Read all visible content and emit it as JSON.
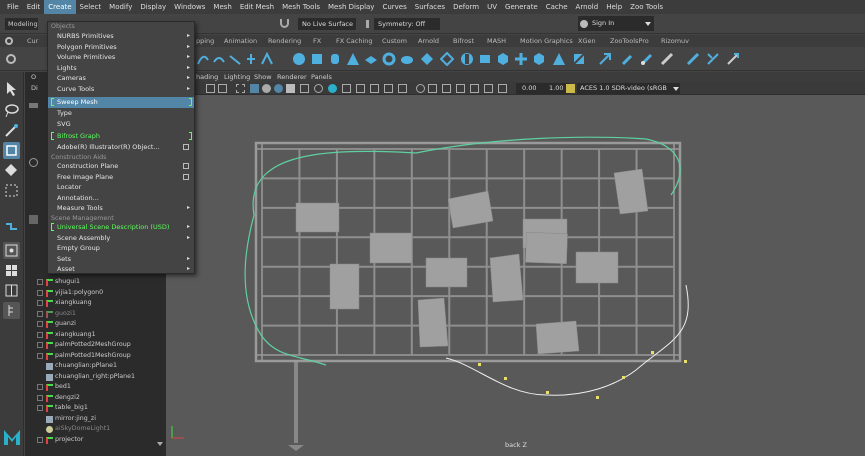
{
  "menubar": [
    "File",
    "Edit",
    "Create",
    "Select",
    "Modify",
    "Display",
    "Windows",
    "Mesh",
    "Edit Mesh",
    "Mesh Tools",
    "Mesh Display",
    "Curves",
    "Surfaces",
    "Deform",
    "UV",
    "Generate",
    "Cache",
    "Arnold",
    "Help",
    "Zoo Tools"
  ],
  "status": {
    "mode": "Modeling",
    "live_surface": "No Live Surface",
    "symmetry": "Symmetry: Off",
    "signin": "Sign In"
  },
  "shelf_tabs": [
    "Cur",
    "pping",
    "Animation",
    "Rendering",
    "FX",
    "FX Caching",
    "Custom",
    "Arnold",
    "Bifrost",
    "MASH",
    "Motion Graphics",
    "XGen",
    "ZooToolsPro",
    "Rizomuv"
  ],
  "viewport_menu": [
    "hading",
    "Lighting",
    "Show",
    "Renderer",
    "Panels"
  ],
  "viewport_fields": {
    "value1": "0.00",
    "value2": "1.00",
    "colorspace": "ACES 1.0 SDR-video (sRGB"
  },
  "outliner_partial": [
    "O",
    "Di"
  ],
  "camera_label": "back Z",
  "create_menu": {
    "header_objects": "Objects",
    "items_a": [
      "NURBS Primitives",
      "Polygon Primitives",
      "Volume Primitives",
      "Lights",
      "Cameras",
      "Curve Tools"
    ],
    "sweep": "Sweep Mesh",
    "type": "Type",
    "svg": "SVG",
    "bifrost": "Bifrost Graph",
    "illustrator": "Adobe(R) Illustrator(R) Object...",
    "header_construction": "Construction Aids",
    "construction_plane": "Construction Plane",
    "free_image_plane": "Free Image Plane",
    "locator": "Locator",
    "annotation": "Annotation...",
    "measure": "Measure Tools",
    "header_scene": "Scene Management",
    "usd": "Universal Scene Description (USD)",
    "scene_assembly": "Scene Assembly",
    "empty_group": "Empty Group",
    "sets": "Sets",
    "asset": "Asset"
  },
  "outliner": [
    "shugui1",
    "yijia1:polygon0",
    "xiangkuang",
    "guozi1",
    "guanzi",
    "xiangkuang1",
    "palmPotted2MeshGroup",
    "palmPotted1MeshGroup",
    "chuanglian:pPlane1",
    "chuanglian_right:pPlane1",
    "bed1",
    "dengzi2",
    "table_big1",
    "mirror:jing_zi",
    "aiSkyDomeLight1",
    "projector"
  ],
  "colors": {
    "accent": "#5285a6",
    "green": "#5aff5a",
    "bg": "#444444",
    "viewport": "#595959"
  }
}
